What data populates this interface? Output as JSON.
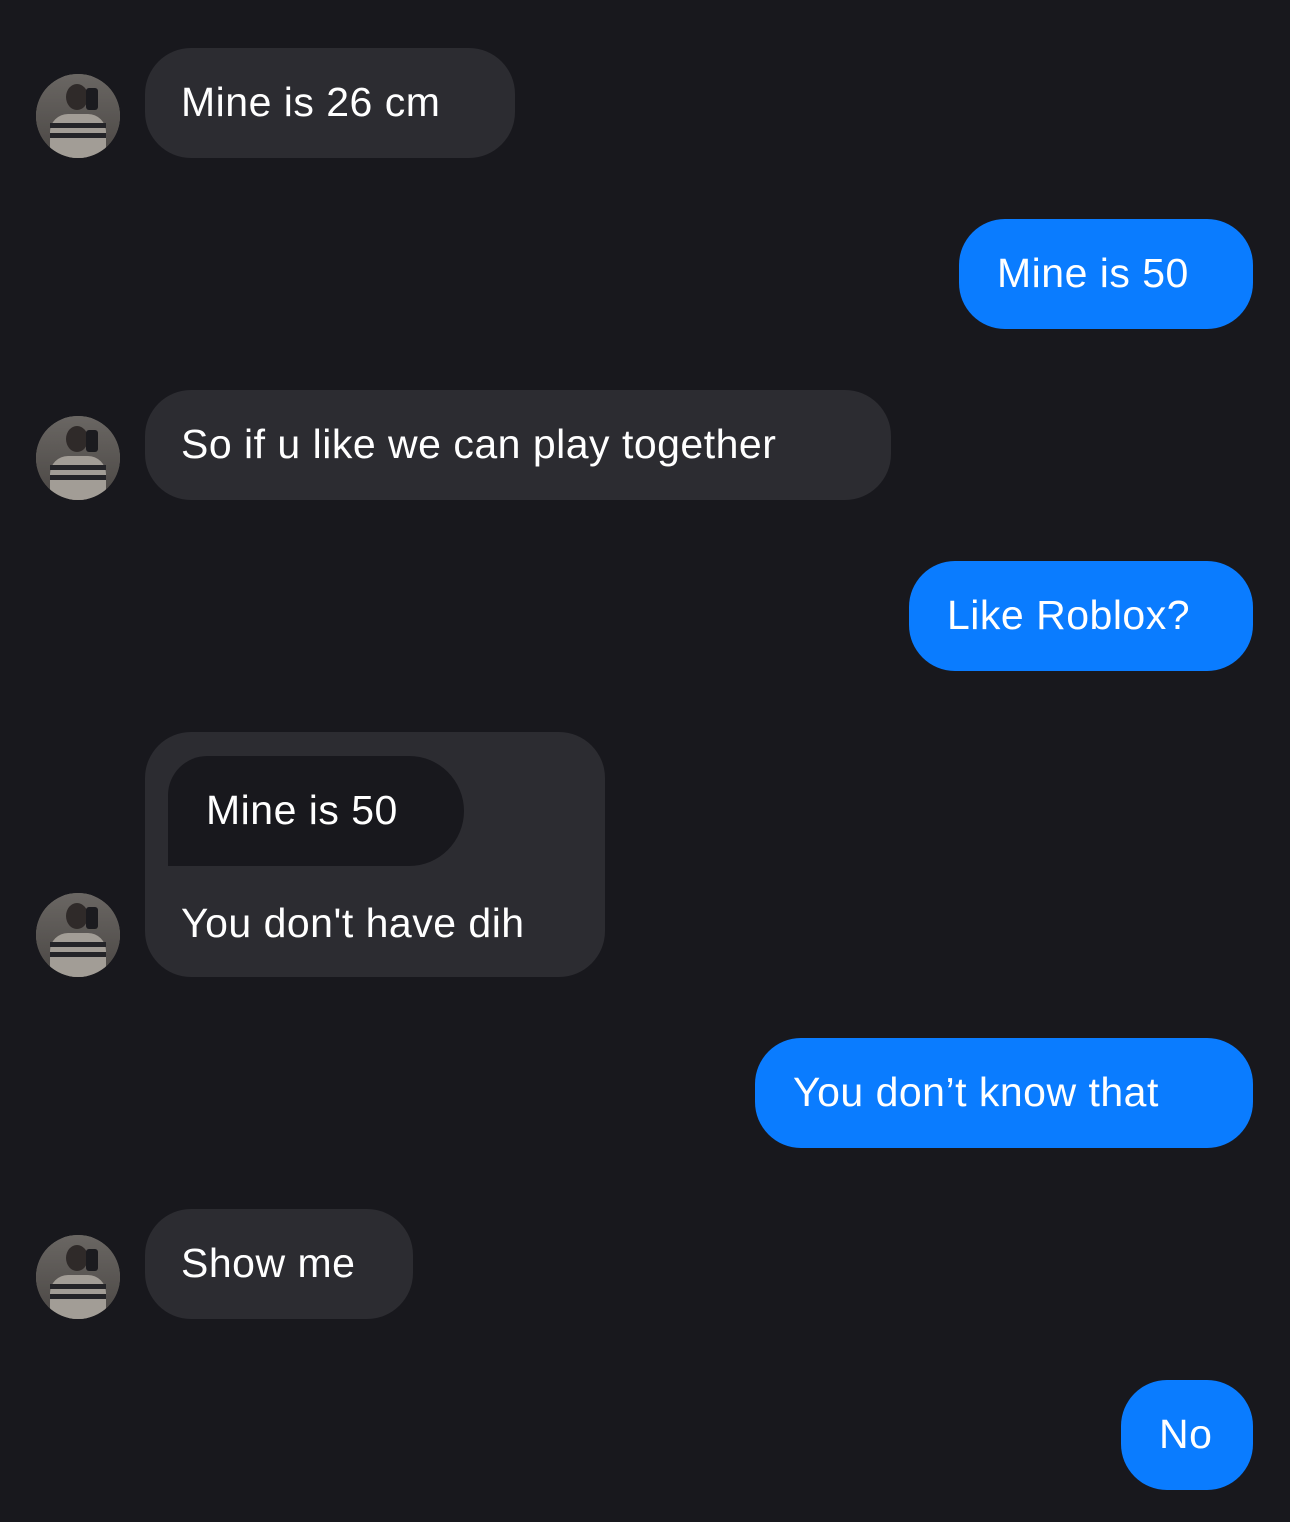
{
  "conversation": {
    "messages": [
      {
        "sender": "them",
        "text": "Mine is 26 cm"
      },
      {
        "sender": "me",
        "text": "Mine is 50"
      },
      {
        "sender": "them",
        "text": "So if u like we can play together"
      },
      {
        "sender": "me",
        "text": "Like Roblox?"
      },
      {
        "sender": "them",
        "quoted_text": "Mine is 50",
        "text": "You don't have dih"
      },
      {
        "sender": "me",
        "text": "You don’t know that"
      },
      {
        "sender": "them",
        "text": "Show me"
      },
      {
        "sender": "me",
        "text": "No"
      }
    ]
  },
  "colors": {
    "background": "#18181d",
    "incoming_bubble": "#2c2c31",
    "outgoing_bubble": "#0a7cff",
    "text": "#ffffff"
  },
  "icons": {
    "avatar": "contact-avatar-photo"
  }
}
